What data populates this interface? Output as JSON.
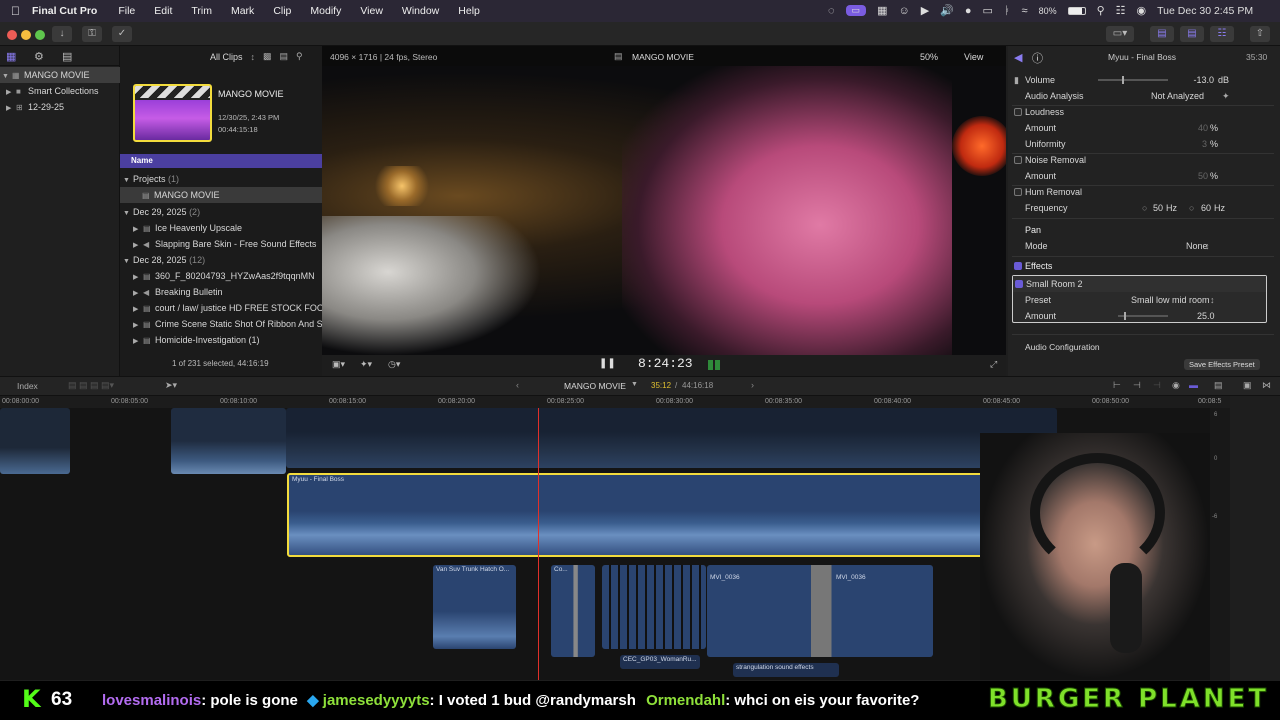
{
  "menubar": {
    "app": "Final Cut Pro",
    "items": [
      "File",
      "Edit",
      "Trim",
      "Mark",
      "Clip",
      "Modify",
      "View",
      "Window",
      "Help"
    ],
    "battery": "80%",
    "datetime": "Tue Dec 30  2:45 PM"
  },
  "browser": {
    "filter": "All Clips",
    "library": "MANGO MOVIE",
    "smart_collections": "Smart Collections",
    "event": "12-29-25",
    "project_thumb": {
      "title": "MANGO MOVIE",
      "date": "12/30/25, 2:43 PM",
      "duration": "00:44:15:18"
    },
    "col_header": "Name",
    "groups": [
      {
        "label": "Projects",
        "count": "(1)",
        "items": [
          "MANGO MOVIE"
        ]
      },
      {
        "label": "Dec 29, 2025",
        "count": "(2)",
        "items": [
          "Ice Heavenly Upscale",
          "Slapping Bare Skin - Free Sound Effects"
        ]
      },
      {
        "label": "Dec 28, 2025",
        "count": "(12)",
        "items": [
          "360_F_80204793_HYZwAas2f9tqqnMN",
          "Breaking Bulletin",
          "court / law/ justice HD FREE STOCK FOO",
          "Crime Scene Static Shot Of Ribbon And S",
          "Homicide-Investigation (1)"
        ]
      }
    ],
    "status": "1 of 231 selected, 44:16:19"
  },
  "viewer": {
    "format": "4096 × 1716 | 24 fps, Stereo",
    "title": "MANGO MOVIE",
    "zoom": "50%",
    "view": "View",
    "timecode": "8:24:23"
  },
  "inspector": {
    "clip": "Myuu - Final Boss",
    "duration": "35:30",
    "volume": {
      "label": "Volume",
      "value": "-13.0",
      "unit": "dB"
    },
    "audio_analysis": {
      "label": "Audio Analysis",
      "value": "Not Analyzed"
    },
    "loudness": {
      "label": "Loudness",
      "amount_label": "Amount",
      "amount": "40",
      "uniformity_label": "Uniformity",
      "uniformity": "3",
      "unit": "%"
    },
    "noise": {
      "label": "Noise Removal",
      "amount_label": "Amount",
      "amount": "50",
      "unit": "%"
    },
    "hum": {
      "label": "Hum Removal",
      "freq_label": "Frequency",
      "opt1": "50",
      "opt2": "60",
      "unit": "Hz"
    },
    "pan": {
      "label": "Pan",
      "mode_label": "Mode",
      "mode": "None"
    },
    "effects": {
      "label": "Effects",
      "fx": "Small Room 2",
      "preset_label": "Preset",
      "preset": "Small low mid room",
      "amount_label": "Amount",
      "amount": "25.0"
    },
    "audio_config": "Audio Configuration",
    "save_button": "Save Effects Preset"
  },
  "timeline": {
    "index": "Index",
    "project": "MANGO MOVIE",
    "position": "35:12",
    "total": "44:16:18",
    "ruler": [
      "00:08:00:00",
      "00:08:05:00",
      "00:08:10:00",
      "00:08:15:00",
      "00:08:20:00",
      "00:08:25:00",
      "00:08:30:00",
      "00:08:35:00",
      "00:08:40:00",
      "00:08:45:00",
      "00:08:50:00",
      "00:08:5"
    ],
    "clips": {
      "main": "Myuu - Final Boss",
      "c1": "Van Suv Trunk Hatch O...",
      "c2": "Co...",
      "c3": "MVI_0036",
      "c4": "MVI_0036",
      "c5": "CEC_GP03_WomanRu...",
      "c6": "strangulation sound effects"
    },
    "meter": [
      "6",
      "0",
      "-6"
    ]
  },
  "ticker": {
    "count": "63",
    "m1_user": "lovesmalinois",
    "m1_text": ": pole is gone",
    "m2_user": "jamesedyyyyts",
    "m2_text": ": I voted 1 bud @randymarsh",
    "m3_user": "Ormendahl",
    "m3_text": ": whci on eis your favorite?",
    "banner": "BURGER PLANET"
  },
  "colors": {
    "accent": "#6a5bd6",
    "selected_clip": "#f3dc3d",
    "playhead": "#e0302a",
    "ticker_green": "#8ee03a",
    "ticker_purple": "#b36cf0",
    "banner": "#7fe02a"
  }
}
